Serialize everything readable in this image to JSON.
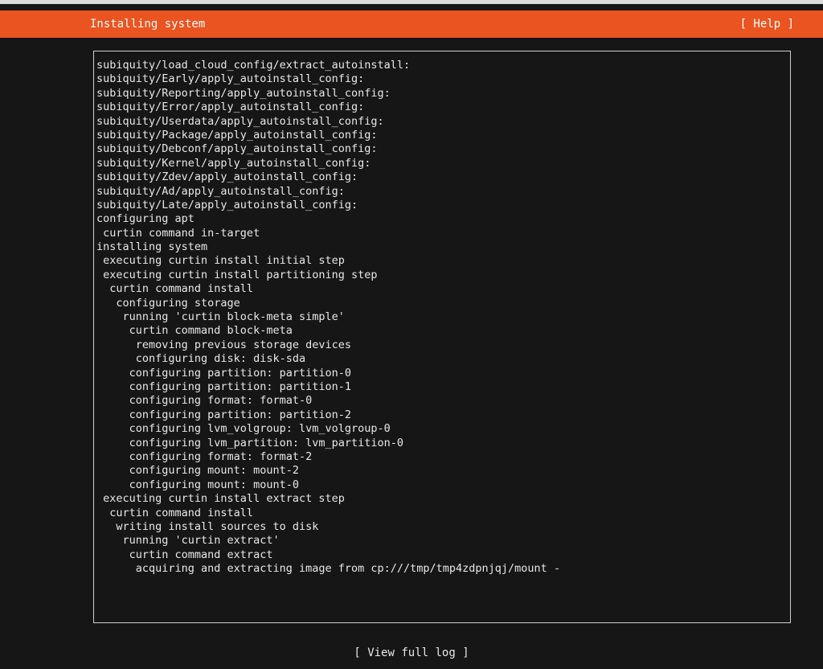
{
  "header": {
    "title": "Installing system",
    "help_label": "[ Help ]"
  },
  "colors": {
    "header_bg": "#e95420",
    "background": "#161616",
    "text": "#e8e8e8"
  },
  "log": {
    "lines": [
      "subiquity/load_cloud_config/extract_autoinstall:",
      "subiquity/Early/apply_autoinstall_config:",
      "subiquity/Reporting/apply_autoinstall_config:",
      "subiquity/Error/apply_autoinstall_config:",
      "subiquity/Userdata/apply_autoinstall_config:",
      "subiquity/Package/apply_autoinstall_config:",
      "subiquity/Debconf/apply_autoinstall_config:",
      "subiquity/Kernel/apply_autoinstall_config:",
      "subiquity/Zdev/apply_autoinstall_config:",
      "subiquity/Ad/apply_autoinstall_config:",
      "subiquity/Late/apply_autoinstall_config:",
      "configuring apt",
      " curtin command in-target",
      "installing system",
      " executing curtin install initial step",
      " executing curtin install partitioning step",
      "  curtin command install",
      "   configuring storage",
      "    running 'curtin block-meta simple'",
      "     curtin command block-meta",
      "      removing previous storage devices",
      "      configuring disk: disk-sda",
      "     configuring partition: partition-0",
      "     configuring partition: partition-1",
      "     configuring format: format-0",
      "     configuring partition: partition-2",
      "     configuring lvm_volgroup: lvm_volgroup-0",
      "     configuring lvm_partition: lvm_partition-0",
      "     configuring format: format-2",
      "     configuring mount: mount-2",
      "     configuring mount: mount-0",
      " executing curtin install extract step",
      "  curtin command install",
      "   writing install sources to disk",
      "    running 'curtin extract'",
      "     curtin command extract",
      "      acquiring and extracting image from cp:///tmp/tmp4zdpnjqj/mount -"
    ]
  },
  "footer": {
    "view_full_log_label": "[ View full log ]"
  }
}
